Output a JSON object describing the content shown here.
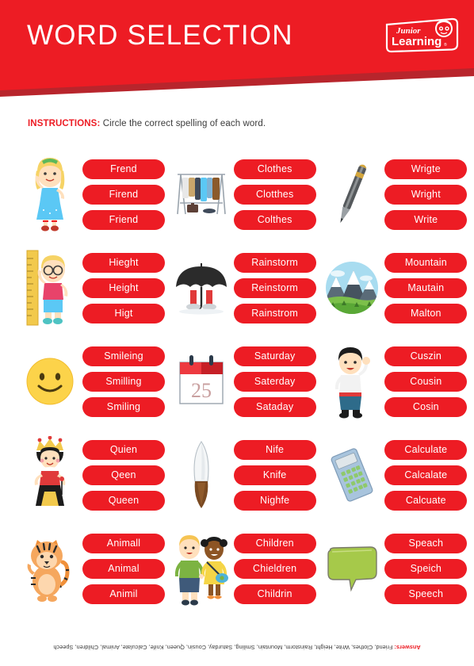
{
  "header": {
    "title": "WORD SELECTION",
    "logo": {
      "line1": "Junior",
      "line2": "Learning",
      "registered": "®"
    },
    "accent_color": "#ed1c24",
    "banner_shadow_color": "#b8252c"
  },
  "instructions": {
    "label": "INSTRUCTIONS:",
    "text": "Circle the correct spelling of each word."
  },
  "rows": [
    {
      "left": {
        "image": "girl-standing-icon",
        "choices": [
          "Frend",
          "Firend",
          "Friend"
        ]
      },
      "middle_left": {
        "image": "clothes-rack-icon",
        "choices": [
          "Clothes",
          "Clotthes",
          "Colthes"
        ]
      },
      "middle_right": {
        "image": "pen-icon",
        "choices": [
          "Wrigte",
          "Wright",
          "Write"
        ]
      }
    },
    {
      "left": {
        "image": "boy-with-ruler-icon",
        "choices": [
          "Hieght",
          "Height",
          "Higt"
        ]
      },
      "middle_left": {
        "image": "umbrella-boots-icon",
        "choices": [
          "Rainstorm",
          "Reinstorm",
          "Rainstrom"
        ]
      },
      "middle_right": {
        "image": "mountain-circle-icon",
        "choices": [
          "Mountain",
          "Mautain",
          "Malton"
        ]
      }
    },
    {
      "left": {
        "image": "smiley-face-icon",
        "choices": [
          "Smileing",
          "Smilling",
          "Smiling"
        ]
      },
      "middle_left": {
        "image": "calendar-icon",
        "choices": [
          "Saturday",
          "Saterday",
          "Sataday"
        ]
      },
      "middle_right": {
        "image": "boy-waving-icon",
        "choices": [
          "Cuszin",
          "Cousin",
          "Cosin"
        ]
      }
    },
    {
      "left": {
        "image": "queen-icon",
        "choices": [
          "Quien",
          "Qeen",
          "Queen"
        ]
      },
      "middle_left": {
        "image": "knife-icon",
        "choices": [
          "Nife",
          "Knife",
          "Nighfe"
        ]
      },
      "middle_right": {
        "image": "calculator-icon",
        "choices": [
          "Calculate",
          "Calcalate",
          "Calcuate"
        ]
      }
    },
    {
      "left": {
        "image": "tiger-icon",
        "choices": [
          "Animall",
          "Animal",
          "Animil"
        ]
      },
      "middle_left": {
        "image": "two-children-icon",
        "choices": [
          "Children",
          "Chieldren",
          "Childrin"
        ]
      },
      "middle_right": {
        "image": "speech-bubble-icon",
        "choices": [
          "Speach",
          "Speich",
          "Speech"
        ]
      }
    }
  ],
  "calendar": {
    "day": "25"
  },
  "answers": {
    "label": "Answers:",
    "text": " Friend, Clothes, Write, Height, Rainstorm, Mountain, Smiling, Saturday, Cousin, Queen, Knife, Calculate, Animal, Children, Speech"
  }
}
